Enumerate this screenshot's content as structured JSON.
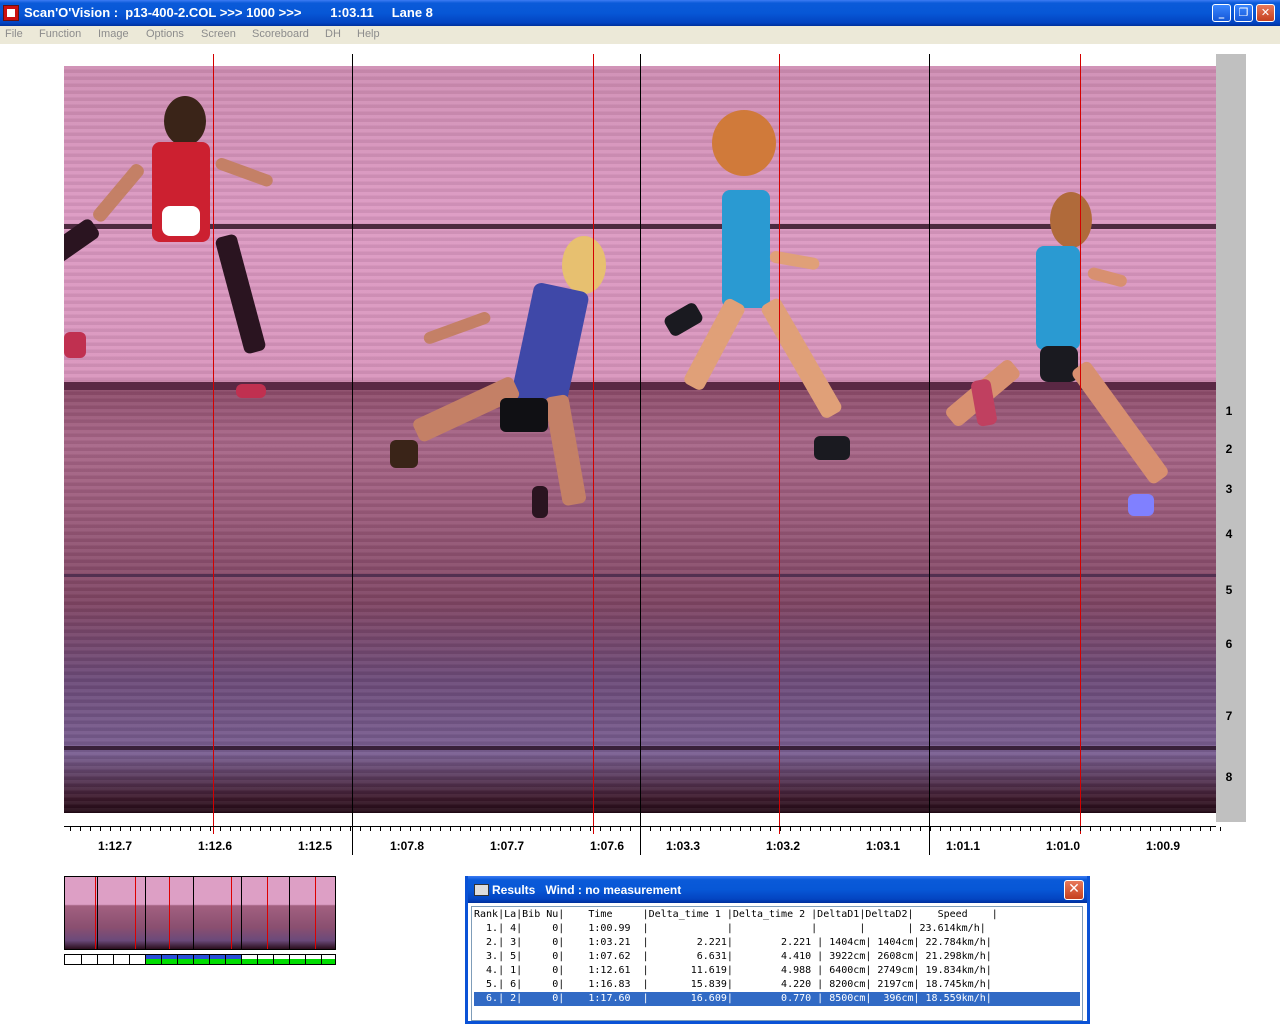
{
  "window": {
    "title": "Scan'O'Vision :  p13-400-2.COL >>> 1000 >>>        1:03.11     Lane 8",
    "minimize": "_",
    "restore": "❐",
    "close": "✕"
  },
  "menu": [
    "File",
    "Function",
    "Image",
    "Options",
    "Screen",
    "Scoreboard",
    "DH",
    "Help"
  ],
  "lanes": [
    "1",
    "2",
    "3",
    "4",
    "5",
    "6",
    "7",
    "8"
  ],
  "time_labels": [
    "1:12.7",
    "1:12.6",
    "1:12.5",
    "1:07.8",
    "1:07.7",
    "1:07.6",
    "1:03.3",
    "1:03.2",
    "1:03.1",
    "1:01.1",
    "1:01.0",
    "1:00.9"
  ],
  "results": {
    "title": "Results   Wind : no measurement",
    "close": "✕",
    "header": "Rank|La|Bib Nu|    Time     |Delta_time 1 |Delta_time 2 |DeltaD1|DeltaD2|    Speed    |",
    "rows": [
      "  1.| 4|     0|    1:00.99  |             |             |       |       | 23.614km/h|",
      "  2.| 3|     0|    1:03.21  |        2.221|        2.221 | 1404cm| 1404cm| 22.784km/h|",
      "  3.| 5|     0|    1:07.62  |        6.631|        4.410 | 3922cm| 2608cm| 21.298km/h|",
      "  4.| 1|     0|    1:12.61  |       11.619|        4.988 | 6400cm| 2749cm| 19.834km/h|",
      "  5.| 6|     0|    1:16.83  |       15.839|        4.220 | 8200cm| 2197cm| 18.745km/h|",
      "  6.| 2|     0|    1:17.60  |       16.609|        0.770 | 8500cm|  396cm| 18.559km/h|"
    ],
    "selected_row": 5
  },
  "colors": {
    "title_blue": "#0757d6",
    "finish_line": "#d40000",
    "selection": "#316ac5",
    "strip_blue": "#2a4fd8",
    "strip_green": "#00dd00"
  }
}
